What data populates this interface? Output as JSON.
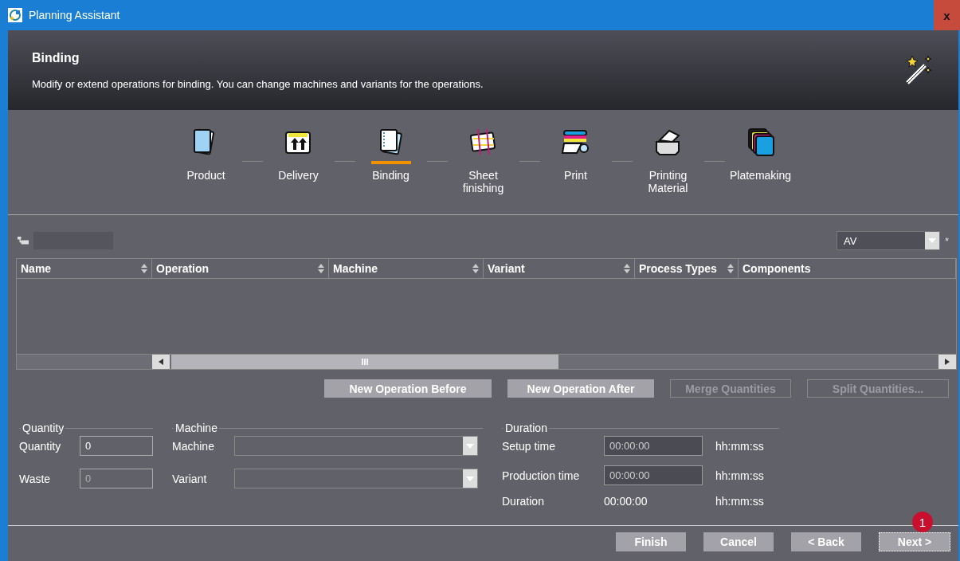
{
  "window": {
    "title": "Planning Assistant",
    "close": "x"
  },
  "header": {
    "title": "Binding",
    "description": "Modify or extend operations for binding. You can change machines and variants for the operations."
  },
  "steps": [
    {
      "label": "Product",
      "kind": "product",
      "selected": false
    },
    {
      "label": "Delivery",
      "kind": "delivery",
      "selected": false
    },
    {
      "label": "Binding",
      "kind": "binding",
      "selected": true
    },
    {
      "label": "Sheet finishing",
      "kind": "finishing",
      "selected": false
    },
    {
      "label": "Print",
      "kind": "print",
      "selected": false
    },
    {
      "label": "Printing Material",
      "kind": "material",
      "selected": false
    },
    {
      "label": "Platemaking",
      "kind": "plates",
      "selected": false
    }
  ],
  "filter": {
    "value": "AV",
    "required_mark": "*"
  },
  "table": {
    "columns": [
      {
        "label": "Name",
        "sortable": true
      },
      {
        "label": "Operation",
        "sortable": true
      },
      {
        "label": "Machine",
        "sortable": true
      },
      {
        "label": "Variant",
        "sortable": true
      },
      {
        "label": "Process Types",
        "sortable": true
      },
      {
        "label": "Components",
        "sortable": false
      }
    ],
    "scrollbar_grip": "III"
  },
  "actions": [
    {
      "label": "New Operation Before",
      "disabled": false
    },
    {
      "label": "New Operation After",
      "disabled": false
    },
    {
      "label": "Merge Quantities",
      "disabled": true
    },
    {
      "label": "Split Quantities...",
      "disabled": true
    }
  ],
  "quantity_group": {
    "title": "Quantity",
    "fields": [
      {
        "label": "Quantity",
        "value": "0",
        "disabled": false
      },
      {
        "label": "Waste",
        "value": "0",
        "disabled": true
      }
    ]
  },
  "machine_group": {
    "title": "Machine",
    "fields": [
      {
        "label": "Machine"
      },
      {
        "label": "Variant"
      }
    ]
  },
  "duration_group": {
    "title": "Duration",
    "rows": [
      {
        "label": "Setup time",
        "value": "00:00:00",
        "kind": "input",
        "unit": "hh:mm:ss"
      },
      {
        "label": "Production time",
        "value": "00:00:00",
        "kind": "input",
        "unit": "hh:mm:ss"
      },
      {
        "label": "Duration",
        "value": "00:00:00",
        "kind": "text",
        "unit": "hh:mm:ss"
      }
    ]
  },
  "footer": {
    "buttons": [
      {
        "label": "Finish",
        "focused": false
      },
      {
        "label": "Cancel",
        "focused": false
      },
      {
        "label": "< Back",
        "focused": false
      },
      {
        "label": "Next >",
        "focused": true,
        "badge": "1"
      }
    ]
  }
}
